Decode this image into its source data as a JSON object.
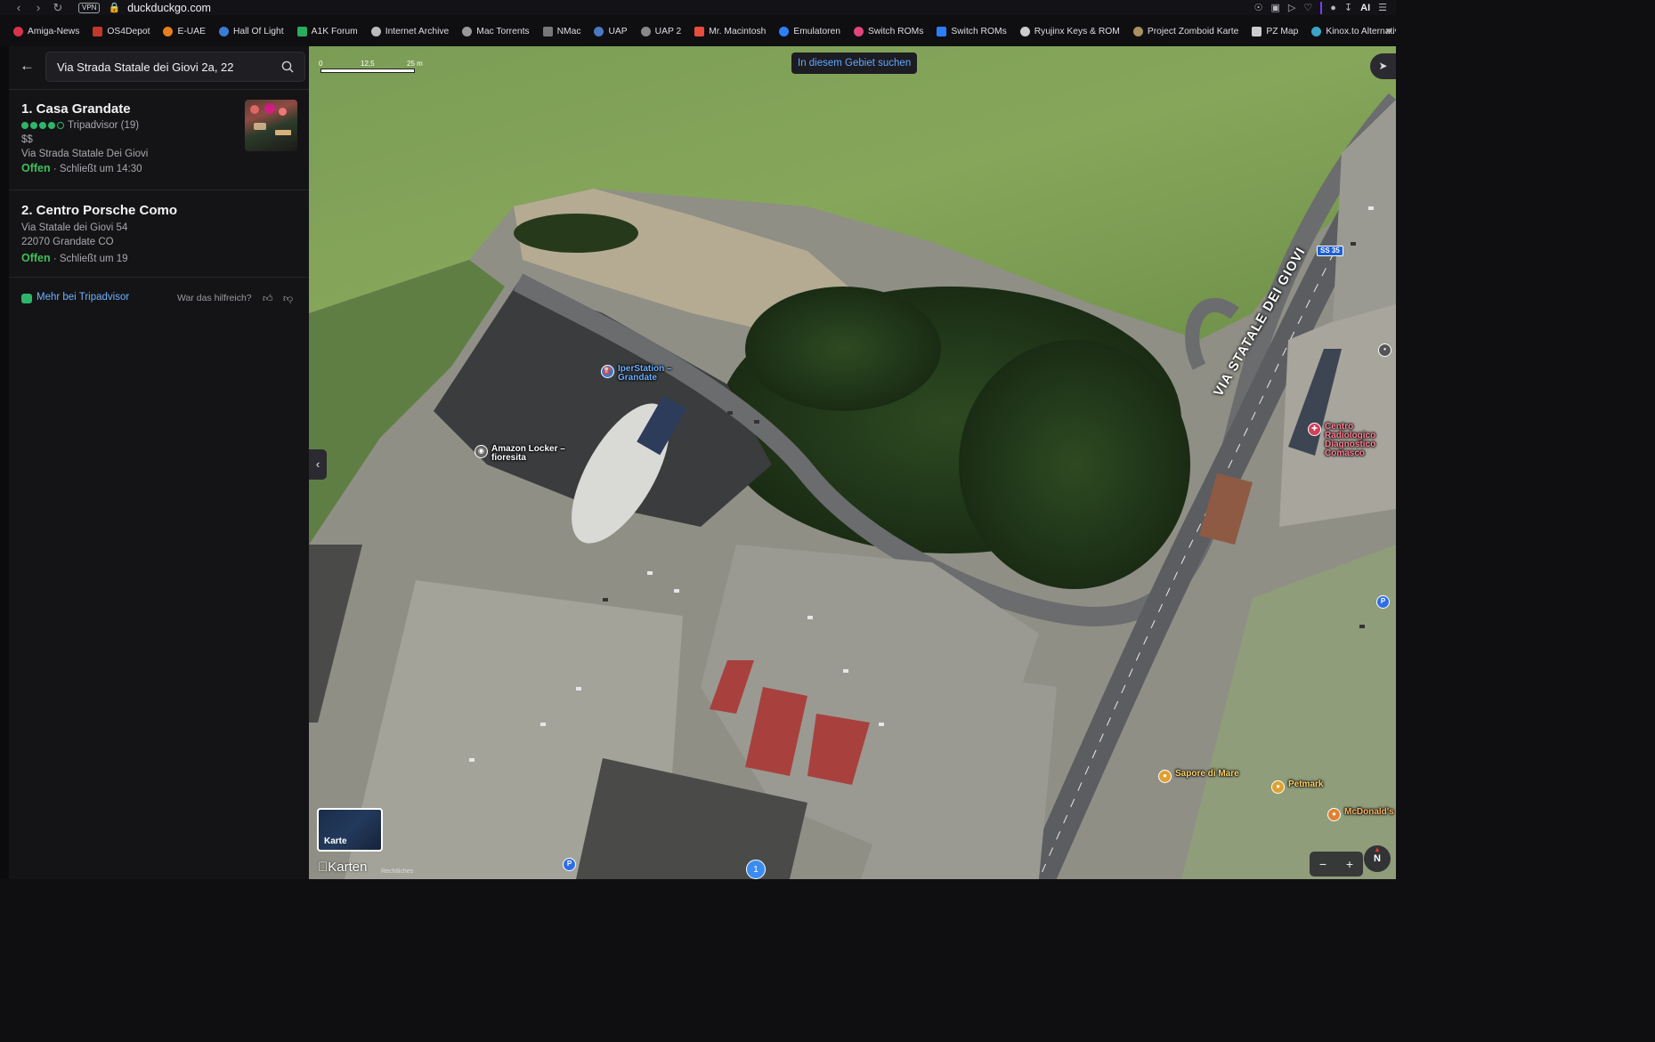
{
  "browser": {
    "url": "duckduckgo.com",
    "vpn_label": "VPN",
    "ai_label": "AI"
  },
  "bookmarks": [
    {
      "label": "Amiga-News",
      "color": "#d8334a"
    },
    {
      "label": "OS4Depot",
      "color": "#c0392b"
    },
    {
      "label": "E-UAE",
      "color": "#e67e22"
    },
    {
      "label": "Hall Of Light",
      "color": "#3a7bd5"
    },
    {
      "label": "A1K Forum",
      "color": "#27ae60"
    },
    {
      "label": "Internet Archive",
      "color": "#bbbbbb"
    },
    {
      "label": "Mac Torrents",
      "color": "#999999"
    },
    {
      "label": "NMac",
      "color": "#777777"
    },
    {
      "label": "UAP",
      "color": "#4a78c2"
    },
    {
      "label": "UAP 2",
      "color": "#888888"
    },
    {
      "label": "Mr. Macintosh",
      "color": "#e74c3c"
    },
    {
      "label": "Emulatoren",
      "color": "#2d7ff9"
    },
    {
      "label": "Switch ROMs",
      "color": "#e0447a"
    },
    {
      "label": "Switch ROMs",
      "color": "#2d7ff9"
    },
    {
      "label": "Ryujinx Keys & ROM",
      "color": "#cccccc"
    },
    {
      "label": "Project Zomboid Karte",
      "color": "#a89060"
    },
    {
      "label": "PZ Map",
      "color": "#cccccc"
    },
    {
      "label": "Kinox.to Alternativen",
      "color": "#3aa5c8"
    }
  ],
  "search": {
    "value": "Via Strada Statale dei Giovi 2a, 22",
    "placeholder": "Suchen"
  },
  "results": [
    {
      "title": "1. Casa Grandate",
      "rating_source": "Tripadvisor (19)",
      "rating": 4,
      "rating_max": 5,
      "price": "$$",
      "address": "Via Strada Statale Dei Giovi",
      "status": "Offen",
      "hours": " · Schließt um 14:30"
    },
    {
      "title": "2. Centro Porsche Como",
      "address": "Via Statale dei Giovi 54",
      "address2": "22070 Grandate CO",
      "status": "Offen",
      "hours": " · Schließt um 19"
    }
  ],
  "footer": {
    "link": "Mehr bei Tripadvisor",
    "question": "War das hilfreich?"
  },
  "map": {
    "search_area_button": "In diesem Gebiet suchen",
    "scale": [
      "0",
      "12,5",
      "25 m"
    ],
    "road_label": "VIA STATALE DEI GIOVI",
    "road_shield": "SS 35",
    "map_type_label": "Karte",
    "attribution": "Karten",
    "legal": "Rechtliches",
    "cluster_count": "1",
    "compass": "N",
    "pois": [
      {
        "label": "IperStation – Grandate",
        "color": "#3a7bd5",
        "label_color": "#6fb0ff"
      },
      {
        "label": "Amazon Locker – fioresita",
        "color": "#666666",
        "label_color": "#ffffff"
      },
      {
        "label": "Centro Radiologico Diagnostico Comasco",
        "color": "#d2405a",
        "label_color": "#ff7f95"
      },
      {
        "label": "Sapore di Mare",
        "color": "#e0a030",
        "label_color": "#ffd36a"
      },
      {
        "label": "Petmark",
        "color": "#e0a030",
        "label_color": "#ffd36a"
      },
      {
        "label": "McDonald's",
        "color": "#e08030",
        "label_color": "#ffb060"
      }
    ]
  }
}
